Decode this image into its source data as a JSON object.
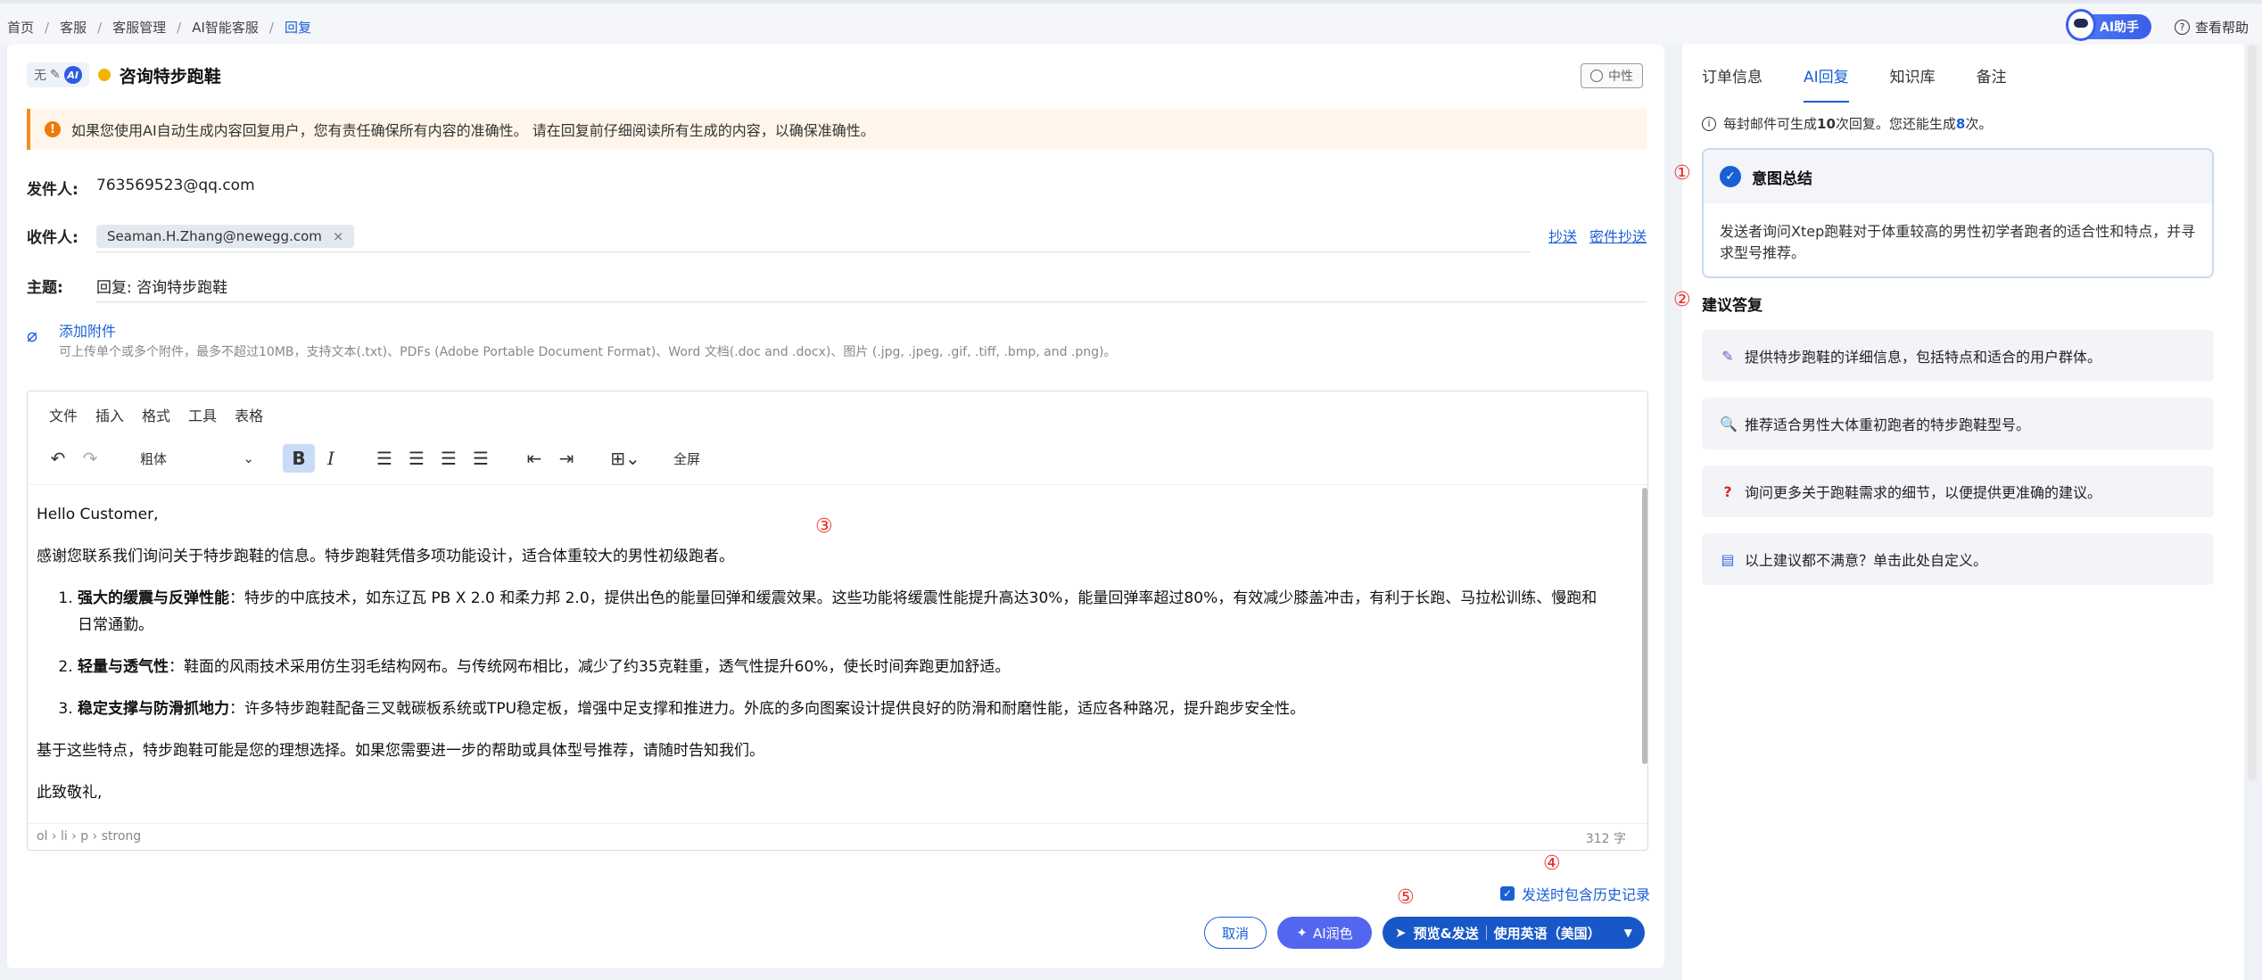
{
  "breadcrumb": [
    "首页",
    "客服",
    "客服管理",
    "AI智能客服",
    "回复"
  ],
  "topbar": {
    "ai_helper": "AI助手",
    "help": "查看帮助"
  },
  "header": {
    "mode_off": "无",
    "mode_ai": "AI",
    "title": "咨询特步跑鞋",
    "sentiment": "中性"
  },
  "warning": "如果您使用AI自动生成内容回复用户，您有责任确保所有内容的准确性。 请在回复前仔细阅读所有生成的内容，以确保准确性。",
  "form": {
    "from_label": "发件人:",
    "from_value": "763569523@qq.com",
    "to_label": "收件人:",
    "to_chip": "Seaman.H.Zhang@newegg.com",
    "cc": "抄送",
    "bcc": "密件抄送",
    "subject_label": "主题:",
    "subject_value": "回复: 咨询特步跑鞋"
  },
  "attachment": {
    "link": "添加附件",
    "hint": "可上传单个或多个附件，最多不超过10MB，支持文本(.txt)、PDFs (Adobe Portable Document Format)、Word 文档(.doc and .docx)、图片 (.jpg, .jpeg, .gif, .tiff, .bmp, and .png)。"
  },
  "editor": {
    "menus": [
      "文件",
      "插入",
      "格式",
      "工具",
      "表格"
    ],
    "font": "粗体",
    "fullscreen": "全屏",
    "greeting": "Hello Customer,",
    "intro": "感谢您联系我们询问关于特步跑鞋的信息。特步跑鞋凭借多项功能设计，适合体重较大的男性初级跑者。",
    "items": [
      {
        "title": "强大的缓震与反弹性能",
        "body": "：特步的中底技术，如东辽瓦 PB X 2.0 和柔力邦 2.0，提供出色的能量回弹和缓震效果。这些功能将缓震性能提升高达30%，能量回弹率超过80%，有效减少膝盖冲击，有利于长跑、马拉松训练、慢跑和日常通勤。"
      },
      {
        "title": "轻量与透气性",
        "body": "：鞋面的风雨技术采用仿生羽毛结构网布。与传统网布相比，减少了约35克鞋重，透气性提升60%，使长时间奔跑更加舒适。"
      },
      {
        "title": "稳定支撑与防滑抓地力",
        "body": "：许多特步跑鞋配备三叉戟碳板系统或TPU稳定板，增强中足支撑和推进力。外底的多向图案设计提供良好的防滑和耐磨性能，适应各种路况，提升跑步安全性。"
      }
    ],
    "closing": "基于这些特点，特步跑鞋可能是您的理想选择。如果您需要进一步的帮助或具体型号推荐，请随时告知我们。",
    "signoff": "此致敬礼,",
    "path": "ol › li › p › strong",
    "word_count": "312 字"
  },
  "markers": [
    "①",
    "②",
    "③",
    "④",
    "⑤"
  ],
  "footer": {
    "history": "发送时包含历史记录",
    "cancel": "取消",
    "polish": "AI润色",
    "send": "预览&发送",
    "lang": "使用英语（美国）"
  },
  "side": {
    "tabs": [
      "订单信息",
      "AI回复",
      "知识库",
      "备注"
    ],
    "quota_pre": "每封邮件可生成",
    "quota_n": "10",
    "quota_mid": "次回复。您还能生成",
    "quota_left": "8",
    "quota_post": "次。",
    "intent_title": "意图总结",
    "intent_body": "发送者询问Xtep跑鞋对于体重较高的男性初学者跑者的适合性和特点，并寻求型号推荐。",
    "sugg_title": "建议答复",
    "suggestions": [
      {
        "icon": "✎",
        "text": "提供特步跑鞋的详细信息，包括特点和适合的用户群体。"
      },
      {
        "icon": "🔍",
        "text": "推荐适合男性大体重初跑者的特步跑鞋型号。"
      },
      {
        "icon": "?",
        "text": "询问更多关于跑鞋需求的细节，以便提供更准确的建议。"
      },
      {
        "icon": "▤",
        "text": "以上建议都不满意？单击此处自定义。"
      }
    ]
  },
  "colors": {
    "primary": "#1a5fd6",
    "warning": "#ee7a0a",
    "marker": "#e8302a",
    "polish": "#5266f0"
  }
}
